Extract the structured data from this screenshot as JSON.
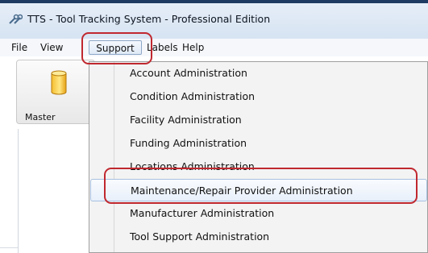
{
  "window": {
    "title": "TTS - Tool Tracking System - Professional Edition"
  },
  "menubar": {
    "items": [
      {
        "label": "File"
      },
      {
        "label": "View"
      },
      {
        "label": "Support"
      },
      {
        "label": "Labels"
      },
      {
        "label": "Help"
      }
    ]
  },
  "toolbar": {
    "master_label": "Master"
  },
  "dropdown": {
    "items": [
      {
        "label": "Account Administration"
      },
      {
        "label": "Condition Administration"
      },
      {
        "label": "Facility Administration"
      },
      {
        "label": "Funding Administration"
      },
      {
        "label": "Locations Administration"
      },
      {
        "label": "Maintenance/Repair Provider Administration"
      },
      {
        "label": "Manufacturer Administration"
      },
      {
        "label": "Tool Support Administration"
      }
    ]
  },
  "colors": {
    "annotation": "#c0282f",
    "menu_highlight_border": "#a9c1e0",
    "titlebar": "#dce7f5"
  }
}
